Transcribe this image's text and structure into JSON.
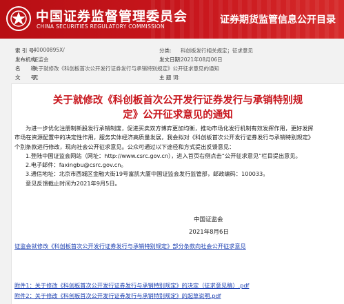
{
  "header": {
    "org_name_cn": "中国证券监督管理委员会",
    "org_name_en": "CHINA SECURITIES REGULATORY COMMISSION",
    "site_title": "证券期货监管信息公开目录"
  },
  "meta": {
    "index_label": "索 引 号:",
    "index_value": "40000895X/",
    "category_label": "分类:",
    "category_value": "科创板发行相关规定；征求意见",
    "publisher_label": "发布机构:",
    "publisher_value": "证监会",
    "date_label": "发文日期:",
    "date_value": "2021年08月06日",
    "name_label": "名　　称:",
    "name_value": "关于就修改《科创板首次公开发行证券发行与承销特别规定》公开征求意见的通知",
    "docno_label": "文　　号:",
    "docno_value": "无",
    "keyword_label": "主 题 词:",
    "keyword_value": ""
  },
  "document": {
    "title_line1": "关于就修改《科创板首次公开发行证券发行与承销特别规",
    "title_line2": "定》公开征求意见的通知",
    "para1_line1": "为进一步优化注册制新股发行承销制度，促进买卖双方博弈更加均衡，推动市场化发行机制有效发挥作用，更好发挥",
    "para1_line2": "市场在资源配置中的决定性作用，服务实体经济高质量发展，我会拟对《科创板首次公开发行证券发行与承销特别规定》",
    "para1_line3": "个别条款进行修改，现向社会公开征求意见。公众可通过以下途径和方式提出反馈意见：",
    "item1": "1.登陆中国证监会网站（网址：http://www.csrc.gov.cn），进入首页右侧点击“公开征求意见”栏目提出意见。",
    "item2": "2.电子邮件：faxingbu@csrc.gov.cn。",
    "item3": "3.通信地址：北京市西城区金融大街19号富凯大厦中国证监会发行监管部，邮政编码：100033。",
    "deadline": "意见反馈截止时间为2021年9月5日。",
    "signature_org": "中国证监会",
    "signature_date": "2021年8月6日"
  },
  "links": {
    "explanation": "证监会就修改《科创板首次公开发行证券发行与承销特别规定》部分条款向社会公开征求意见",
    "attachment1": "附件1：关于修改《科创板首次公开发行证券发行与承销特别规定》的决定（征求意见稿）.pdf",
    "attachment2": "附件2：关于修改《科创板首次公开发行证券发行与承销特别规定》的起草说明.pdf"
  },
  "colors": {
    "header_red": "#c8161d",
    "title_red": "#c8161d",
    "link_blue": "#1a3eb0"
  }
}
